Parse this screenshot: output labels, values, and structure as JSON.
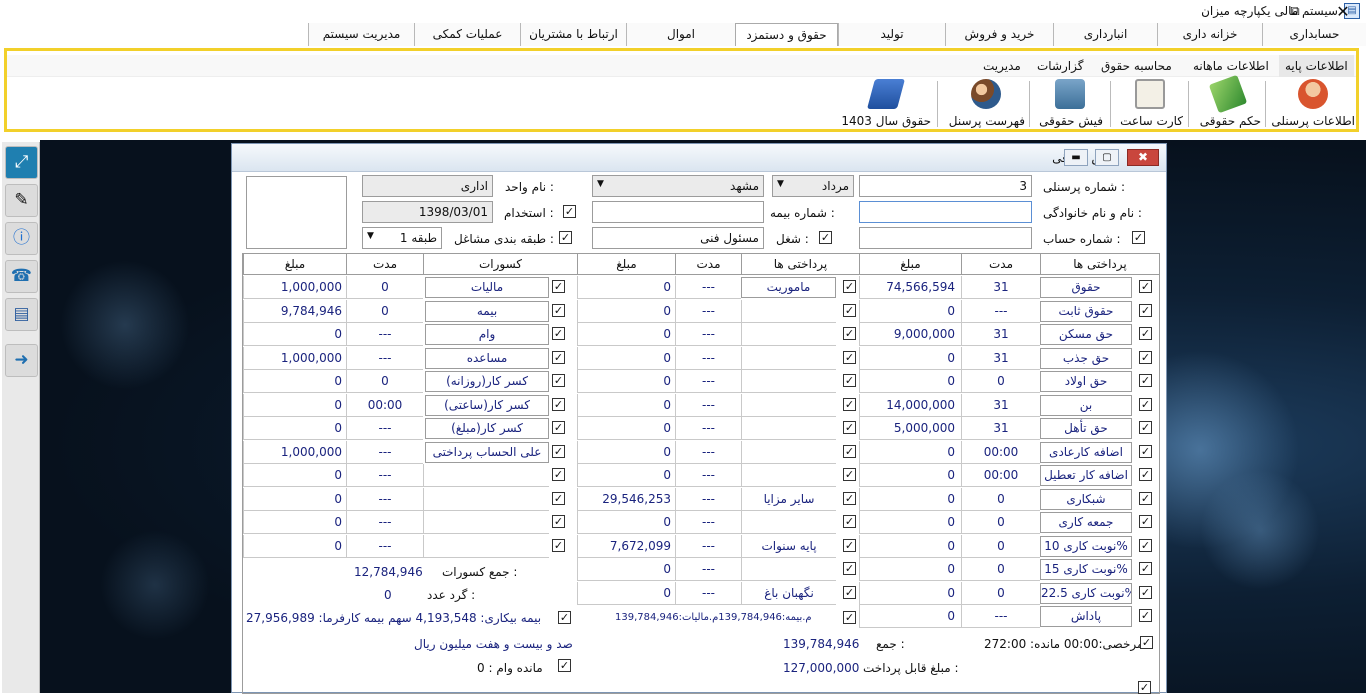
{
  "app": {
    "title": "سیستم مالی یکپارچه میزان",
    "restore_glyph": "⧉",
    "close_glyph": "✕"
  },
  "menu_tabs": [
    "حسابداری",
    "خزانه داری",
    "انبارداری",
    "خرید و فروش",
    "تولید",
    "حقوق و دستمزد",
    "اموال",
    "ارتباط با مشتریان",
    "عملیات کمکی",
    "مدیریت سیستم"
  ],
  "sub_tabs": [
    "اطلاعات پایه",
    "اطلاعات ماهانه",
    "محاسبه حقوق",
    "گزارشات",
    "مدیریت"
  ],
  "ribbon_buttons": [
    {
      "label": "اطلاعات پرسنلی",
      "icon": "person-icon"
    },
    {
      "label": "حکم حقوقی",
      "icon": "decree-icon"
    },
    {
      "label": "کارت ساعت",
      "icon": "timecard-icon"
    },
    {
      "label": "فیش حقوقی",
      "icon": "wallet-icon"
    },
    {
      "label": "فهرست پرسنل",
      "icon": "people-icon"
    },
    {
      "label": "حقوق سال 1403",
      "icon": "book-icon"
    }
  ],
  "window": {
    "title": "فیش حقوقی"
  },
  "form": {
    "personnel_no_label": "شماره پرسنلی :",
    "personnel_no": "3",
    "month": "مرداد",
    "city": "مشهد",
    "unit_label": "نام واحد :",
    "unit": "اداری",
    "name_label": "نام و نام خانوادگی :",
    "name": "",
    "insurance_label": "شماره بیمه :",
    "hire_label": "استخدام :",
    "hire_date": "1398/03/01",
    "account_label": "شماره حساب :",
    "job_label": "شغل :",
    "job": "مسئول فنی",
    "class_label": "طبقه بندی مشاغل :",
    "class_value": "طبقه 1"
  },
  "headers": {
    "pay": "پرداختی ها",
    "duration": "مدت",
    "amount": "مبلغ",
    "pay2": "پرداختی ها",
    "duration2": "مدت",
    "amount2": "مبلغ",
    "deductions": "کسورات",
    "duration3": "مدت",
    "amount3": "مبلغ"
  },
  "pay_rows": [
    {
      "name": "حقوق",
      "duration": "31",
      "amount": "74,566,594"
    },
    {
      "name": "حقوق ثابت",
      "duration": "---",
      "amount": "0"
    },
    {
      "name": "حق مسکن",
      "duration": "31",
      "amount": "9,000,000"
    },
    {
      "name": "حق جذب",
      "duration": "31",
      "amount": "0"
    },
    {
      "name": "حق اولاد",
      "duration": "0",
      "amount": "0"
    },
    {
      "name": "بن",
      "duration": "31",
      "amount": "14,000,000"
    },
    {
      "name": "حق تأهل",
      "duration": "31",
      "amount": "5,000,000"
    },
    {
      "name": "اضافه کارعادی",
      "duration": "00:00",
      "amount": "0"
    },
    {
      "name": "اضافه کار تعطیل",
      "duration": "00:00",
      "amount": "0"
    },
    {
      "name": "شبکاری",
      "duration": "0",
      "amount": "0"
    },
    {
      "name": "جمعه کاری",
      "duration": "0",
      "amount": "0"
    },
    {
      "name": "نوبت کاری 10%",
      "duration": "0",
      "amount": "0"
    },
    {
      "name": "نوبت کاری 15%",
      "duration": "0",
      "amount": "0"
    },
    {
      "name": "نوبت کاری 22.5%",
      "duration": "0",
      "amount": "0"
    },
    {
      "name": "پاداش",
      "duration": "---",
      "amount": "0"
    }
  ],
  "pay2_rows": [
    {
      "name": "ماموریت",
      "duration": "---",
      "amount": "0"
    },
    {
      "name": "",
      "duration": "---",
      "amount": "0"
    },
    {
      "name": "",
      "duration": "---",
      "amount": "0"
    },
    {
      "name": "",
      "duration": "---",
      "amount": "0"
    },
    {
      "name": "",
      "duration": "---",
      "amount": "0"
    },
    {
      "name": "",
      "duration": "---",
      "amount": "0"
    },
    {
      "name": "",
      "duration": "---",
      "amount": "0"
    },
    {
      "name": "",
      "duration": "---",
      "amount": "0"
    },
    {
      "name": "",
      "duration": "---",
      "amount": "0"
    },
    {
      "name": "سایر مزایا",
      "duration": "---",
      "amount": "29,546,253"
    },
    {
      "name": "",
      "duration": "---",
      "amount": "0"
    },
    {
      "name": "پایه سنوات",
      "duration": "---",
      "amount": "7,672,099"
    },
    {
      "name": "",
      "duration": "---",
      "amount": "0"
    },
    {
      "name": "نگهبان باغ",
      "duration": "---",
      "amount": "0"
    }
  ],
  "ded_rows": [
    {
      "name": "مالیات",
      "duration": "0",
      "amount": "1,000,000"
    },
    {
      "name": "بیمه",
      "duration": "0",
      "amount": "9,784,946"
    },
    {
      "name": "وام",
      "duration": "---",
      "amount": "0"
    },
    {
      "name": "مساعده",
      "duration": "---",
      "amount": "1,000,000"
    },
    {
      "name": "کسر کار(روزانه)",
      "duration": "0",
      "amount": "0"
    },
    {
      "name": "کسر کار(ساعتی)",
      "duration": "00:00",
      "amount": "0"
    },
    {
      "name": "کسر کار(مبلغ)",
      "duration": "---",
      "amount": "0"
    },
    {
      "name": "علی الحساب پرداختی",
      "duration": "---",
      "amount": "1,000,000"
    },
    {
      "name": "",
      "duration": "---",
      "amount": "0"
    },
    {
      "name": "",
      "duration": "---",
      "amount": "0"
    },
    {
      "name": "",
      "duration": "---",
      "amount": "0"
    },
    {
      "name": "",
      "duration": "---",
      "amount": "0"
    }
  ],
  "totals": {
    "ded_total_label": "جمع کسورات :",
    "ded_total": "12,784,946",
    "round_label": "گرد عدد :",
    "round": "0",
    "insurance_line": "م.بیمه:139,784,946م.مالیات:139,784,946",
    "unemployment": "بیمه بیکاری: 4,193,548 سهم بیمه کارفرما: 27,956,989",
    "leave_line": "مرخصی:00:00 مانده: 272:00",
    "sum_label": "جمع :",
    "sum": "139,784,946",
    "words": "صد و بیست و هفت میلیون ریال",
    "payable_label": "مبلغ قابل پرداخت :",
    "payable": "127,000,000",
    "loan_balance": "مانده وام : 0"
  }
}
